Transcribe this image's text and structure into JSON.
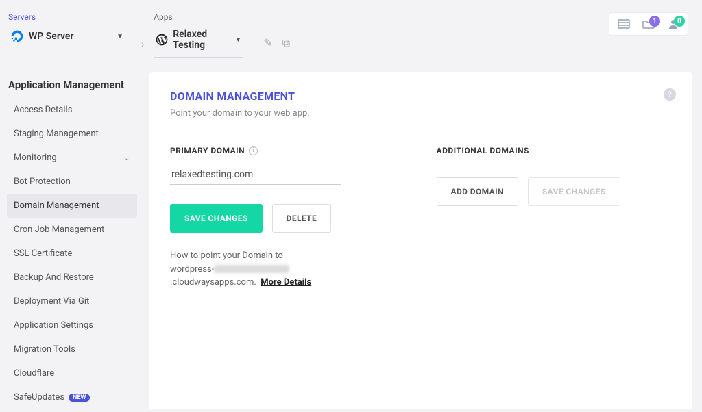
{
  "breadcrumb": {
    "servers_label": "Servers",
    "server_name": "WP Server",
    "apps_label": "Apps",
    "app_name": "Relaxed Testing"
  },
  "topbar": {
    "folder_badge": "1",
    "user_badge": "0"
  },
  "sidebar": {
    "heading": "Application Management",
    "items": [
      {
        "label": "Access Details"
      },
      {
        "label": "Staging Management"
      },
      {
        "label": "Monitoring",
        "expandable": true
      },
      {
        "label": "Bot Protection"
      },
      {
        "label": "Domain Management",
        "active": true
      },
      {
        "label": "Cron Job Management"
      },
      {
        "label": "SSL Certificate"
      },
      {
        "label": "Backup And Restore"
      },
      {
        "label": "Deployment Via Git"
      },
      {
        "label": "Application Settings"
      },
      {
        "label": "Migration Tools"
      },
      {
        "label": "Cloudflare"
      },
      {
        "label": "SafeUpdates",
        "badge": "NEW"
      }
    ]
  },
  "card": {
    "title": "DOMAIN MANAGEMENT",
    "subtitle": "Point your domain to your web app.",
    "primary": {
      "label": "PRIMARY DOMAIN",
      "value": "relaxedtesting.com",
      "save_label": "SAVE CHANGES",
      "delete_label": "DELETE",
      "help_prefix": "How to point your Domain to",
      "help_host_prefix": "wordpress-",
      "help_host_suffix": ".cloudwaysapps.com.",
      "more_label": "More Details"
    },
    "additional": {
      "label": "ADDITIONAL DOMAINS",
      "add_label": "ADD DOMAIN",
      "save_label": "SAVE CHANGES"
    }
  }
}
